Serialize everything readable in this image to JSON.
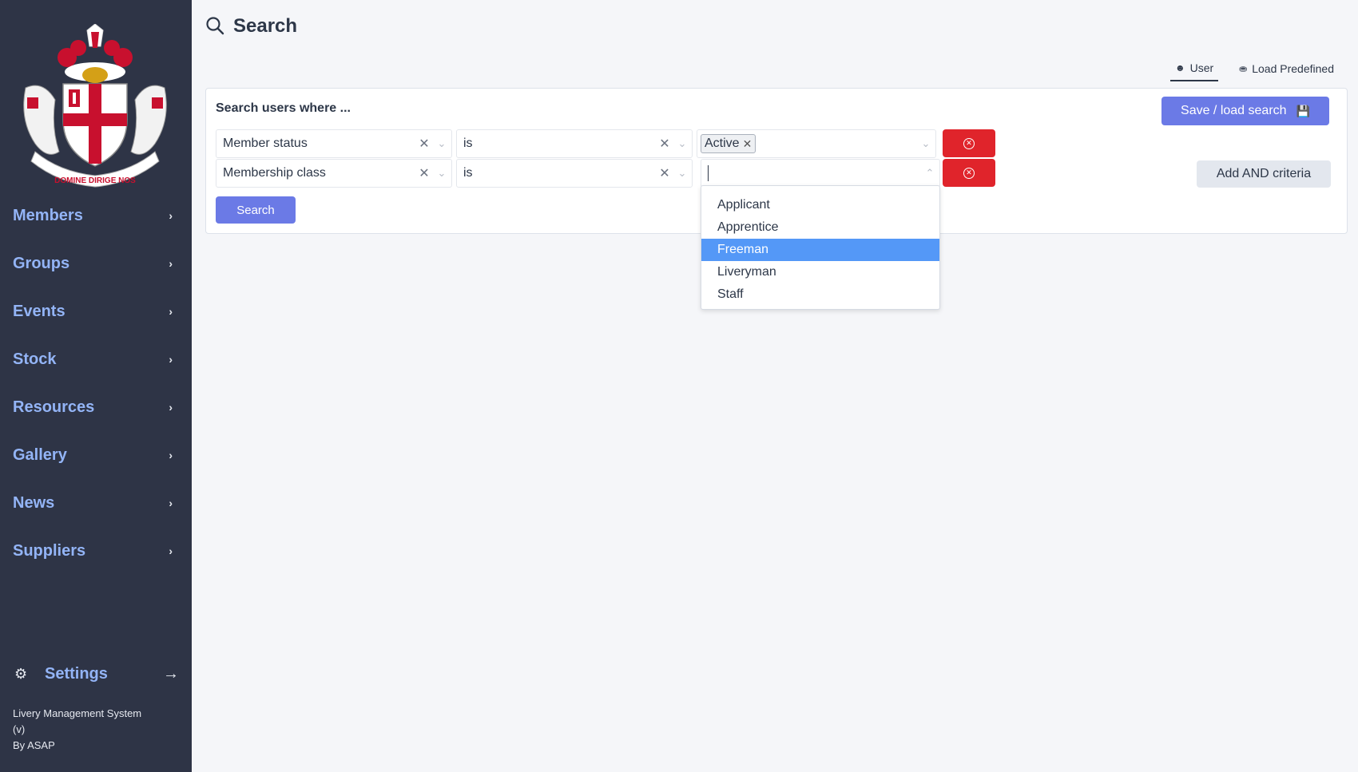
{
  "colors": {
    "sidebar_bg": "#2e3446",
    "nav_label": "#93b4f6",
    "primary": "#6b7ae6",
    "danger": "#e0242b",
    "highlight": "#5498f7"
  },
  "logo": {
    "motto": "DOMINE DIRIGE NOS"
  },
  "sidebar": {
    "items": [
      {
        "label": "Members",
        "icon": "chevron-right-icon"
      },
      {
        "label": "Groups",
        "icon": "chevron-right-icon"
      },
      {
        "label": "Events",
        "icon": "chevron-right-icon"
      },
      {
        "label": "Stock",
        "icon": "chevron-right-icon"
      },
      {
        "label": "Resources",
        "icon": "chevron-right-icon"
      },
      {
        "label": "Gallery",
        "icon": "chevron-right-icon"
      },
      {
        "label": "News",
        "icon": "chevron-right-icon"
      },
      {
        "label": "Suppliers",
        "icon": "chevron-right-icon"
      }
    ],
    "settings_label": "Settings",
    "footer_line1": "Livery Management System",
    "footer_line2": "(v)",
    "footer_line3": "By ASAP"
  },
  "header": {
    "title": "Search"
  },
  "tabs": [
    {
      "label": "User",
      "icon": "user-icon",
      "active": true
    },
    {
      "label": "Load Predefined",
      "icon": "database-icon",
      "active": false
    }
  ],
  "search_panel": {
    "title": "Search users where ...",
    "save_label": "Save / load search",
    "add_label": "Add AND criteria",
    "search_label": "Search",
    "criteria": [
      {
        "field": "Member status",
        "operator": "is",
        "values": [
          "Active"
        ]
      },
      {
        "field": "Membership class",
        "operator": "is",
        "values": []
      }
    ]
  },
  "dropdown": {
    "options": [
      "Applicant",
      "Apprentice",
      "Freeman",
      "Liveryman",
      "Staff"
    ],
    "highlighted": "Freeman"
  }
}
